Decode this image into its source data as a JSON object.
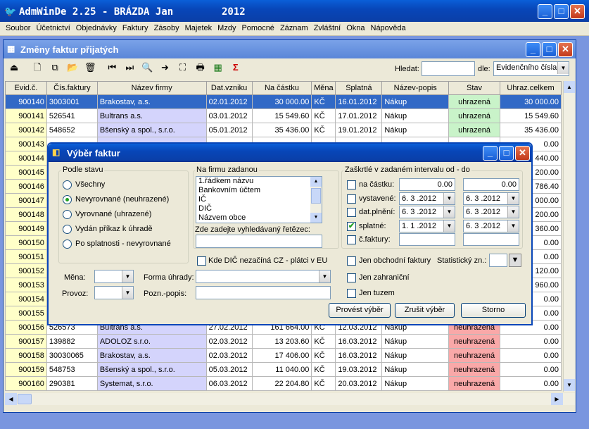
{
  "app": {
    "title": "AdmWinDe 2.25 - BRÁZDA Jan",
    "year": "2012",
    "icon": "bird-logo-icon"
  },
  "menu": [
    "Soubor",
    "Účetnictví",
    "Objednávky",
    "Faktury",
    "Zásoby",
    "Majetek",
    "Mzdy",
    "Pomocné",
    "Záznam",
    "Zvláštní",
    "Okna",
    "Nápověda"
  ],
  "child": {
    "title": "Změny faktur přijatých"
  },
  "search": {
    "label": "Hledat:",
    "value": "",
    "by_label": "dle:",
    "by_value": "Evidenčního čísla"
  },
  "columns": [
    "Evid.č.",
    "Čís.faktury",
    "Název firmy",
    "Dat.vzniku",
    "Na částku",
    "Měna",
    "Splatná",
    "Název-popis",
    "Stav",
    "Uhraz.celkem"
  ],
  "rows": [
    {
      "ev": "900140",
      "fak": "3003001",
      "firma": "Brakostav, a.s.",
      "dat": "02.01.2012",
      "castka": "30 000.00",
      "mena": "KČ",
      "spl": "16.01.2012",
      "popis": "Nákup",
      "stav": "uhrazená",
      "uhraz": "30 000.00",
      "cls": "ok",
      "sel": true
    },
    {
      "ev": "900141",
      "fak": "526541",
      "firma": "Bultrans a.s.",
      "dat": "03.01.2012",
      "castka": "15 549.60",
      "mena": "KČ",
      "spl": "17.01.2012",
      "popis": "Nákup",
      "stav": "uhrazená",
      "uhraz": "15 549.60",
      "cls": "ok"
    },
    {
      "ev": "900142",
      "fak": "548652",
      "firma": "Bšenský a spol., s.r.o.",
      "dat": "05.01.2012",
      "castka": "35 436.00",
      "mena": "KČ",
      "spl": "19.01.2012",
      "popis": "Nákup",
      "stav": "uhrazená",
      "uhraz": "35 436.00",
      "cls": "ok"
    },
    {
      "ev": "900143",
      "uhraz": "0.00"
    },
    {
      "ev": "900144",
      "uhraz": "440.00"
    },
    {
      "ev": "900145",
      "uhraz": "200.00"
    },
    {
      "ev": "900146",
      "uhraz": "786.40"
    },
    {
      "ev": "900147",
      "uhraz": "000.00"
    },
    {
      "ev": "900148",
      "uhraz": "200.00"
    },
    {
      "ev": "900149",
      "uhraz": "360.00"
    },
    {
      "ev": "900150",
      "uhraz": "0.00"
    },
    {
      "ev": "900151",
      "uhraz": "0.00"
    },
    {
      "ev": "900152",
      "uhraz": "120.00"
    },
    {
      "ev": "900153",
      "uhraz": "960.00"
    },
    {
      "ev": "900154",
      "uhraz": "0.00"
    },
    {
      "ev": "900155",
      "uhraz": "0.00"
    },
    {
      "ev": "900156",
      "fak": "526573",
      "firma": "Bultrans a.s.",
      "dat": "27.02.2012",
      "castka": "161 664.00",
      "mena": "KČ",
      "spl": "12.03.2012",
      "popis": "Nákup",
      "stav": "neuhrazená",
      "uhraz": "0.00",
      "cls": "bad"
    },
    {
      "ev": "900157",
      "fak": "139882",
      "firma": "ADOLOZ s.r.o.",
      "dat": "02.03.2012",
      "castka": "13 203.60",
      "mena": "KČ",
      "spl": "16.03.2012",
      "popis": "Nákup",
      "stav": "neuhrazená",
      "uhraz": "0.00",
      "cls": "bad"
    },
    {
      "ev": "900158",
      "fak": "30030065",
      "firma": "Brakostav, a.s.",
      "dat": "02.03.2012",
      "castka": "17 406.00",
      "mena": "KČ",
      "spl": "16.03.2012",
      "popis": "Nákup",
      "stav": "neuhrazená",
      "uhraz": "0.00",
      "cls": "bad"
    },
    {
      "ev": "900159",
      "fak": "548753",
      "firma": "Bšenský a spol., s.r.o.",
      "dat": "05.03.2012",
      "castka": "11 040.00",
      "mena": "KČ",
      "spl": "19.03.2012",
      "popis": "Nákup",
      "stav": "neuhrazená",
      "uhraz": "0.00",
      "cls": "bad"
    },
    {
      "ev": "900160",
      "fak": "290381",
      "firma": "Systemat, s.r.o.",
      "dat": "06.03.2012",
      "castka": "22 204.80",
      "mena": "KČ",
      "spl": "20.03.2012",
      "popis": "Nákup",
      "stav": "neuhrazená",
      "uhraz": "0.00",
      "cls": "bad"
    }
  ],
  "dialog": {
    "title": "Výběr faktur",
    "podle_stavu": {
      "label": "Podle stavu",
      "options": [
        "Všechny",
        "Nevyrovnané (neuhrazené)",
        "Vyrovnané (uhrazené)",
        "Vydán příkaz k úhradě",
        "Po splatnosti - nevyrovnané"
      ],
      "selected": 1
    },
    "firma": {
      "label": "Na firmu zadanou",
      "options": [
        "1.řádkem názvu",
        "Bankovním účtem",
        "IČ",
        "DIČ",
        "Názvem obce"
      ],
      "search_label": "Zde zadejte vyhledávaný řetězec:",
      "search_value": ""
    },
    "dic_check": "Kde DIČ nezačíná CZ  - plátci v EU",
    "interval": {
      "label": "Zaškrtlé v zadaném intervalu od - do",
      "rows": [
        {
          "label": "na částku:",
          "from": "0.00",
          "to": "0.00",
          "checked": false,
          "dd": false
        },
        {
          "label": "vystavené:",
          "from": "6. 3 .2012",
          "to": "6. 3 .2012",
          "checked": false,
          "dd": true
        },
        {
          "label": "dat.plnění:",
          "from": "6. 3 .2012",
          "to": "6. 3 .2012",
          "checked": false,
          "dd": true
        },
        {
          "label": "splatné:",
          "from": "1. 1 .2012",
          "to": "6. 3 .2012",
          "checked": true,
          "dd": true
        },
        {
          "label": "č.faktury:",
          "from": "",
          "to": "",
          "checked": false,
          "dd": false
        }
      ]
    },
    "jen_obchodni": "Jen obchodní faktury",
    "statisticky": "Statistický zn.:",
    "jen_zahranicni": "Jen zahraniční",
    "jen_tuzem": "Jen tuzem",
    "mena_label": "Měna:",
    "provoz_label": "Provoz:",
    "forma_label": "Forma úhrady:",
    "pozn_label": "Pozn.-popis:",
    "btn_provest": "Provést výběr",
    "btn_zrusit": "Zrušit výběr",
    "btn_storno": "Storno"
  }
}
